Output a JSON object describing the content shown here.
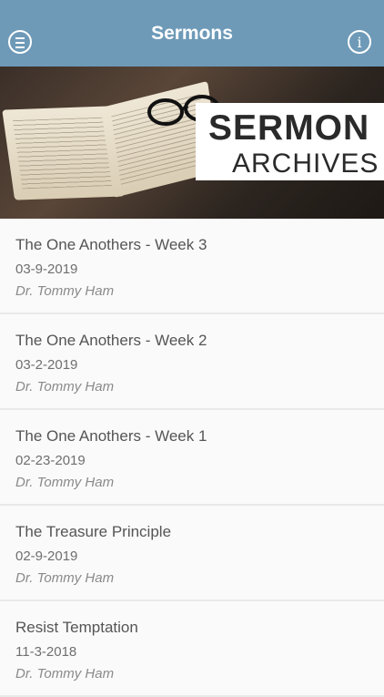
{
  "header": {
    "title": "Sermons",
    "menu_icon": "menu-icon",
    "info_icon": "info-icon"
  },
  "banner": {
    "line1": "SERMON",
    "line2": "ARCHIVES"
  },
  "sermons": [
    {
      "title": "The One Anothers - Week 3",
      "date": "03-9-2019",
      "speaker": "Dr. Tommy Ham"
    },
    {
      "title": "The One Anothers - Week 2",
      "date": "03-2-2019",
      "speaker": "Dr. Tommy Ham"
    },
    {
      "title": "The One Anothers - Week 1",
      "date": "02-23-2019",
      "speaker": "Dr. Tommy Ham"
    },
    {
      "title": "The Treasure Principle",
      "date": "02-9-2019",
      "speaker": "Dr. Tommy Ham"
    },
    {
      "title": "Resist Temptation",
      "date": "11-3-2018",
      "speaker": "Dr. Tommy Ham"
    }
  ]
}
